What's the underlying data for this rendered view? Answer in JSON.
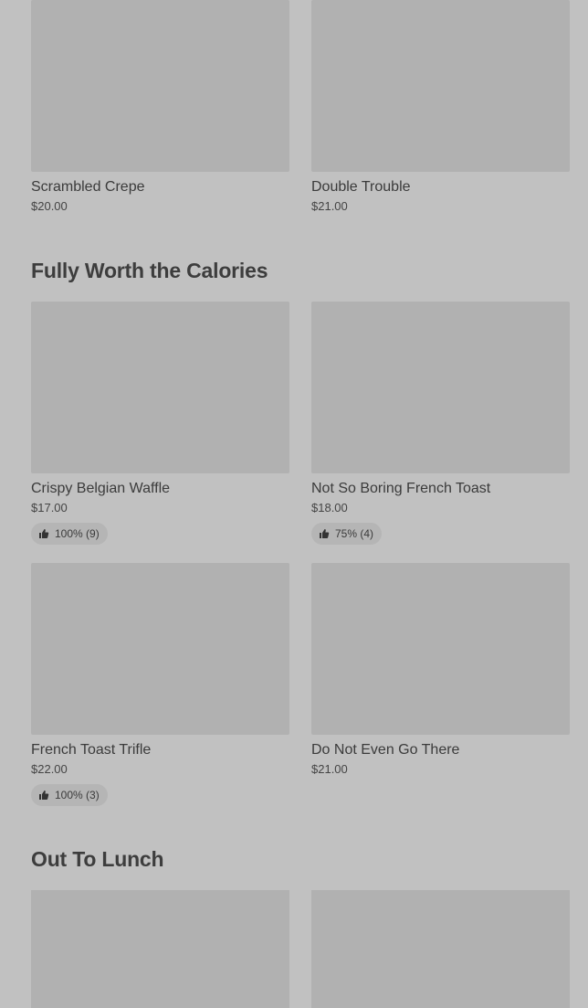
{
  "sections": [
    {
      "title": "",
      "items": [
        {
          "name": "Scrambled Crepe",
          "price": "$20.00"
        },
        {
          "name": "Double Trouble",
          "price": "$21.00"
        }
      ]
    },
    {
      "title": "Fully Worth the Calories",
      "items": [
        {
          "name": "Crispy Belgian Waffle",
          "price": "$17.00",
          "rating": "100% (9)"
        },
        {
          "name": "Not So Boring French Toast",
          "price": "$18.00",
          "rating": "75% (4)"
        },
        {
          "name": "French Toast Trifle",
          "price": "$22.00",
          "rating": "100% (3)"
        },
        {
          "name": "Do Not Even Go There",
          "price": "$21.00"
        }
      ]
    },
    {
      "title": "Out To Lunch",
      "items": []
    }
  ],
  "icons": {
    "rating": "thumbs-up-icon"
  },
  "colors": {
    "background": "#c1c1c1",
    "image_placeholder": "#b1b1b1",
    "badge": "#b5b5b5"
  }
}
